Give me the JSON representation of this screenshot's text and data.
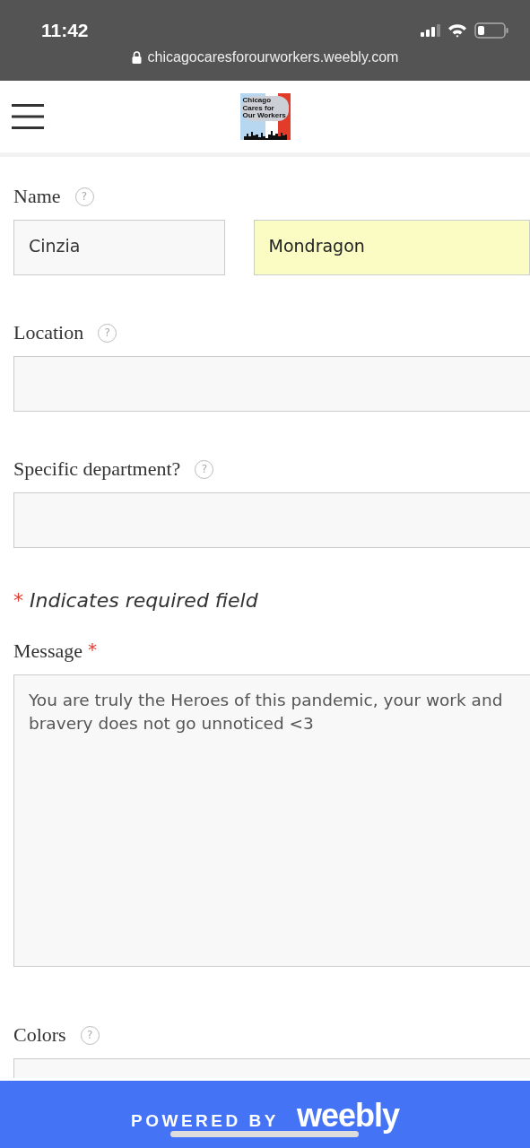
{
  "status_bar": {
    "time": "11:42",
    "url": "chicagocaresforourworkers.weebly.com"
  },
  "header": {
    "logo_text": "Chicago Cares for Our Workers"
  },
  "form": {
    "fields": [
      {
        "kind": "name",
        "label": "Name",
        "help": "?",
        "inputs": [
          {
            "value": "Cinzia",
            "highlighted": false
          },
          {
            "value": "Mondragon",
            "highlighted": true
          }
        ]
      },
      {
        "kind": "text",
        "label": "Location",
        "help": "?",
        "inputs": [
          {
            "highlighted": false
          }
        ]
      },
      {
        "kind": "text",
        "label": "Specific department?",
        "help": "?",
        "inputs": [
          {
            "highlighted": false
          }
        ]
      },
      {
        "kind": "note",
        "label": "Indicates required field",
        "mark": "*"
      },
      {
        "kind": "textarea",
        "label": "Message",
        "mark": "*",
        "inputs": [
          {
            "value": "You are truly the Heroes of this pandemic, your work and\nbravery does not go unnoticed <3",
            "highlighted": false
          }
        ]
      },
      {
        "kind": "select",
        "label": "Colors",
        "help": "?"
      }
    ]
  },
  "banner": {
    "prefix": "POWERED BY",
    "brand": "weebly"
  }
}
